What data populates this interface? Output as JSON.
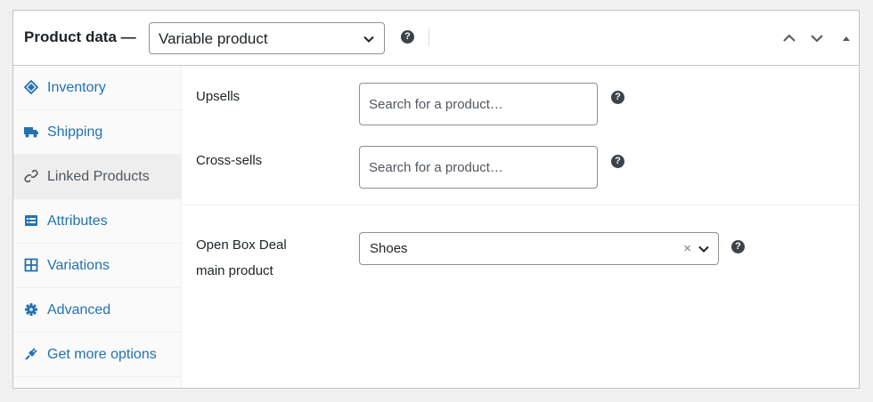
{
  "header": {
    "title": "Product data —",
    "product_type": "Variable product",
    "help_symbol": "?",
    "controls": [
      "chevron-up-icon",
      "chevron-down-icon",
      "triangle-up-icon"
    ]
  },
  "tabs": [
    {
      "label": "Inventory",
      "icon": "inventory-tag-icon",
      "active": false
    },
    {
      "label": "Shipping",
      "icon": "truck-icon",
      "active": false
    },
    {
      "label": "Linked Products",
      "icon": "link-icon",
      "active": true
    },
    {
      "label": "Attributes",
      "icon": "list-icon",
      "active": false
    },
    {
      "label": "Variations",
      "icon": "grid-icon",
      "active": false
    },
    {
      "label": "Advanced",
      "icon": "gear-icon",
      "active": false
    },
    {
      "label": "Get more options",
      "icon": "plugin-icon",
      "active": false
    }
  ],
  "linked": {
    "upsells": {
      "label": "Upsells",
      "placeholder": "Search for a product…"
    },
    "cross_sells": {
      "label": "Cross-sells",
      "placeholder": "Search for a product…"
    }
  },
  "open_box": {
    "label_line1": "Open Box Deal",
    "label_line2": "main product",
    "selected": "Shoes",
    "clear_symbol": "×"
  },
  "colors": {
    "link": "#2271b1",
    "active_tab_bg": "#eeeeee",
    "help_icon": "#3c434a"
  }
}
